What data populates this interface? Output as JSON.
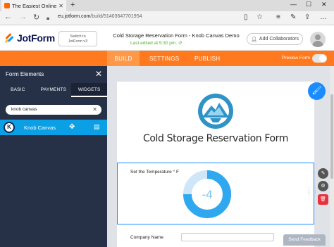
{
  "browser": {
    "tab_title": "The Easiest Online Form",
    "new_tab": "+",
    "address_host": "eu.jotform.com",
    "address_path": "/build/51403647701954",
    "controls": {
      "min": "—",
      "max": "☐",
      "close": "✕"
    }
  },
  "header": {
    "logo_text": "JotForm",
    "switch_line1": "Switch to",
    "switch_line2": "JotForm v3",
    "form_title": "Cold Storage Reservation Form - Knob Canvas Demo",
    "last_edited": "Last edited at 5:30 pm.",
    "add_collaborators": "Add Collaborators"
  },
  "toolbar": {
    "tabs": [
      {
        "label": "BUILD",
        "active": true
      },
      {
        "label": "SETTINGS",
        "active": false
      },
      {
        "label": "PUBLISH",
        "active": false
      }
    ],
    "preview_label": "Preview Form",
    "preview_enabled": false
  },
  "sidebar": {
    "title": "Form Elements",
    "tabs": [
      {
        "label": "BASIC",
        "active": false
      },
      {
        "label": "PAYMENTS",
        "active": false
      },
      {
        "label": "WIDGETS",
        "active": true
      }
    ],
    "search_value": "knob canvas",
    "results": [
      {
        "label": "Knob Canvas",
        "icon": "knob-canvas-icon"
      }
    ]
  },
  "form": {
    "heading": "Cold Storage Reservation Form",
    "temperature_label": "Set the Temperature ° F",
    "knob_value": "-4",
    "knob_fraction": 0.75,
    "company_label": "Company Name"
  },
  "feedback": "Send Feedback",
  "colors": {
    "orange": "#ff7a1e",
    "panel": "#263147",
    "accent": "#1a8cff",
    "knob": "#2fa8ef",
    "knob_track": "#cfe6f8"
  }
}
